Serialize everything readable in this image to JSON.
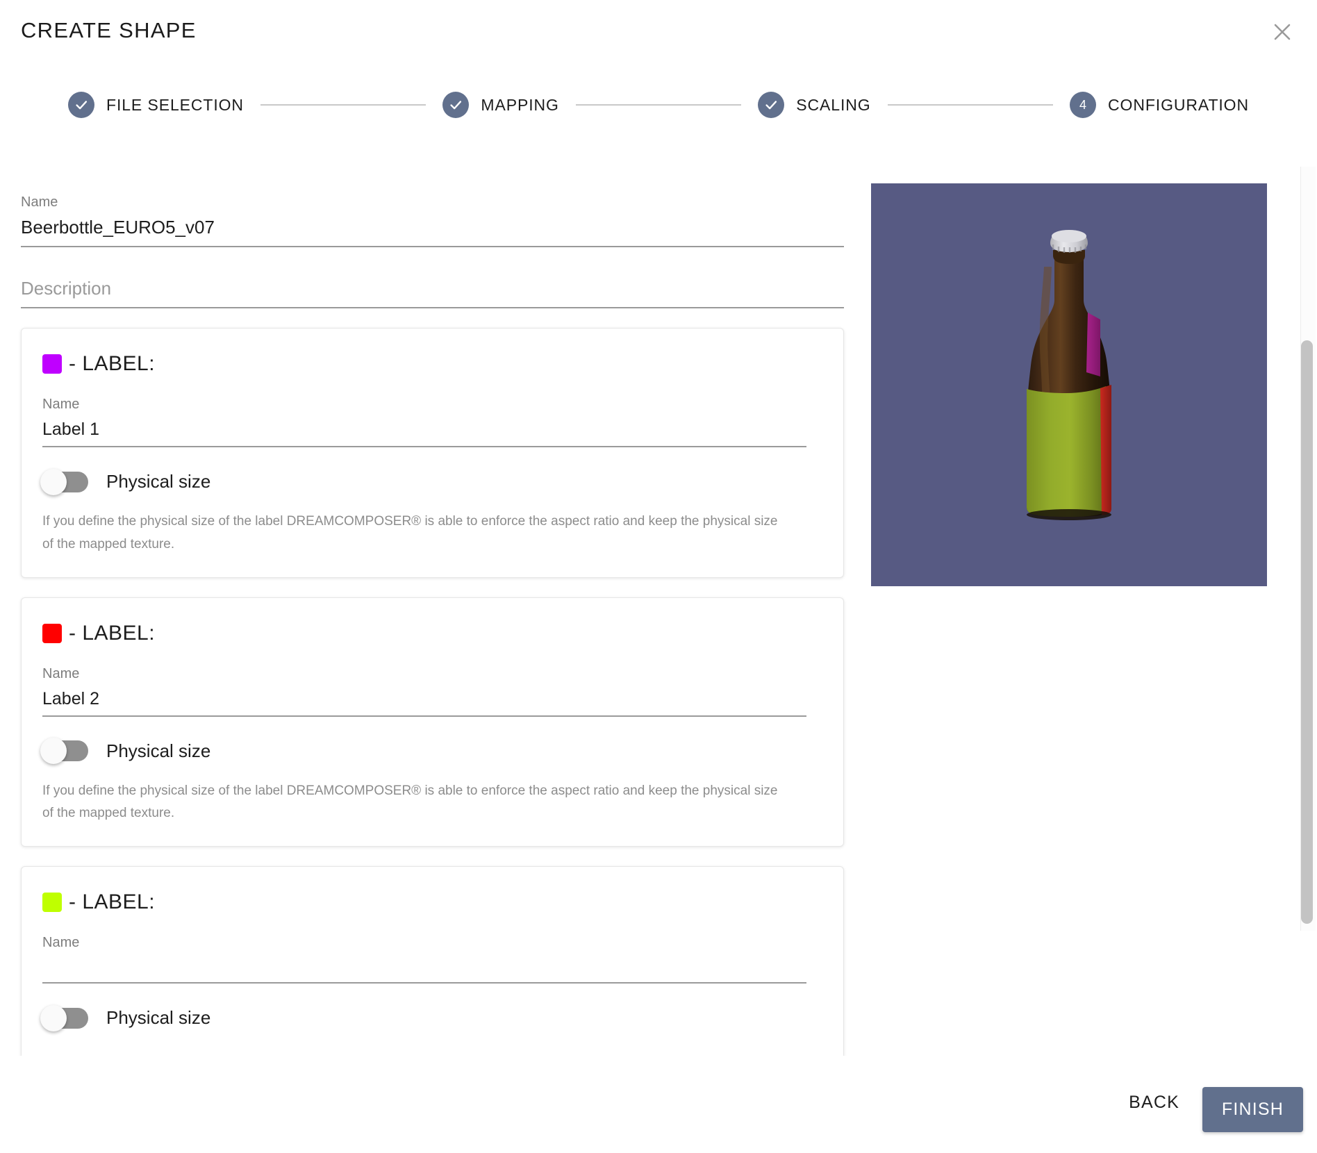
{
  "header": {
    "title": "CREATE SHAPE",
    "close_icon": "close-icon"
  },
  "stepper": {
    "steps": [
      {
        "label": "FILE SELECTION",
        "state": "complete",
        "marker": "check-icon"
      },
      {
        "label": "MAPPING",
        "state": "complete",
        "marker": "check-icon"
      },
      {
        "label": "SCALING",
        "state": "complete",
        "marker": "check-icon"
      },
      {
        "label": "CONFIGURATION",
        "state": "active",
        "marker": "4"
      }
    ],
    "accent_color": "#61708D"
  },
  "form": {
    "name": {
      "label": "Name",
      "value": "Beerbottle_EURO5_v07"
    },
    "description": {
      "label": "Description",
      "value": "",
      "placeholder": "Description"
    }
  },
  "label_cards": [
    {
      "color": "#BF00FF",
      "heading": "- LABEL:",
      "name_label": "Name",
      "name_value": "Label 1",
      "toggle_label": "Physical size",
      "toggle_state": "off",
      "hint": "If you define the physical size of the label DREAMCOMPOSER® is able to enforce the aspect ratio and keep the physical size of the mapped texture."
    },
    {
      "color": "#FF0000",
      "heading": "- LABEL:",
      "name_label": "Name",
      "name_value": "Label 2",
      "toggle_label": "Physical size",
      "toggle_state": "off",
      "hint": "If you define the physical size of the label DREAMCOMPOSER® is able to enforce the aspect ratio and keep the physical size of the mapped texture."
    },
    {
      "color": "#BFFF00",
      "heading": "- LABEL:",
      "name_label": "Name",
      "name_value": "",
      "toggle_label": "Physical size",
      "toggle_state": "off",
      "hint": ""
    }
  ],
  "preview": {
    "background_color": "#575A83",
    "object": "beer-bottle-3d",
    "bottle_glass_color": "#2B1A0E",
    "cap_color": "#D8D8DC",
    "body_label_color": "#8CA326",
    "side_strip_color": "#C0241E",
    "neck_patch_color": "#9C1F7E"
  },
  "footer": {
    "back_label": "BACK",
    "finish_label": "FINISH",
    "finish_color": "#61708D"
  },
  "scrollbar": {
    "orientation": "vertical",
    "thumb_color": "#C3C3C3"
  }
}
